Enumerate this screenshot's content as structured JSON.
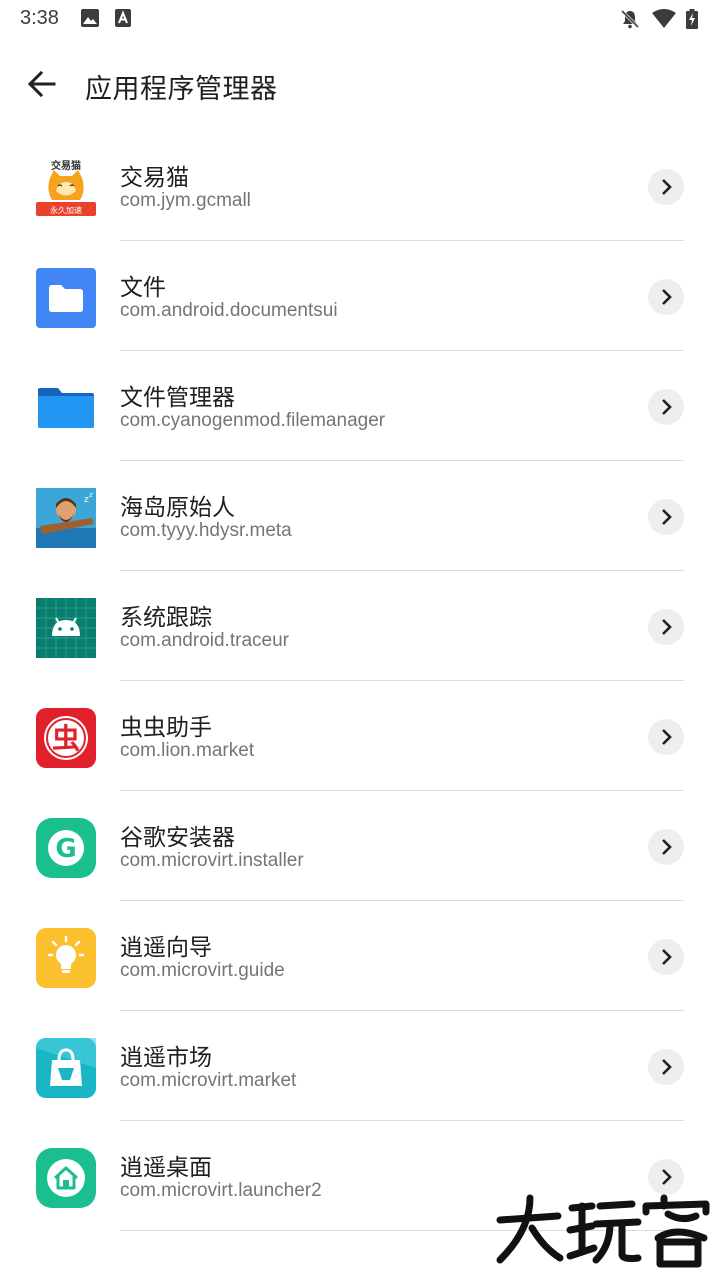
{
  "status_bar": {
    "time": "3:38",
    "left_icons": [
      "image-icon",
      "a-badge-icon"
    ],
    "right_icons": [
      "notifications-off-icon",
      "wifi-icon",
      "battery-charging-icon"
    ]
  },
  "header": {
    "back_icon": "arrow-back-icon",
    "title": "应用程序管理器"
  },
  "apps": [
    {
      "name": "交易猫",
      "package": "com.jym.gcmall",
      "icon": "jiaoyimao-icon",
      "icon_text": "交易猫",
      "icon_subtext": "永久加速"
    },
    {
      "name": "文件",
      "package": "com.android.documentsui",
      "icon": "files-icon"
    },
    {
      "name": "文件管理器",
      "package": "com.cyanogenmod.filemanager",
      "icon": "file-manager-icon"
    },
    {
      "name": "海岛原始人",
      "package": "com.tyyy.hdysr.meta",
      "icon": "island-caveman-icon"
    },
    {
      "name": "系统跟踪",
      "package": "com.android.traceur",
      "icon": "android-icon"
    },
    {
      "name": "虫虫助手",
      "package": "com.lion.market",
      "icon": "chongchong-icon",
      "icon_text": "虫"
    },
    {
      "name": "谷歌安装器",
      "package": "com.microvirt.installer",
      "icon": "google-installer-icon",
      "icon_text": "G"
    },
    {
      "name": "逍遥向导",
      "package": "com.microvirt.guide",
      "icon": "lightbulb-icon"
    },
    {
      "name": "逍遥市场",
      "package": "com.microvirt.market",
      "icon": "shopping-bag-icon"
    },
    {
      "name": "逍遥桌面",
      "package": "com.microvirt.launcher2",
      "icon": "home-icon"
    }
  ],
  "watermark": "大玩客",
  "colors": {
    "divider": "#dcdcdc",
    "secondary_text": "#757575",
    "chevron_bg": "#eeeeee"
  }
}
